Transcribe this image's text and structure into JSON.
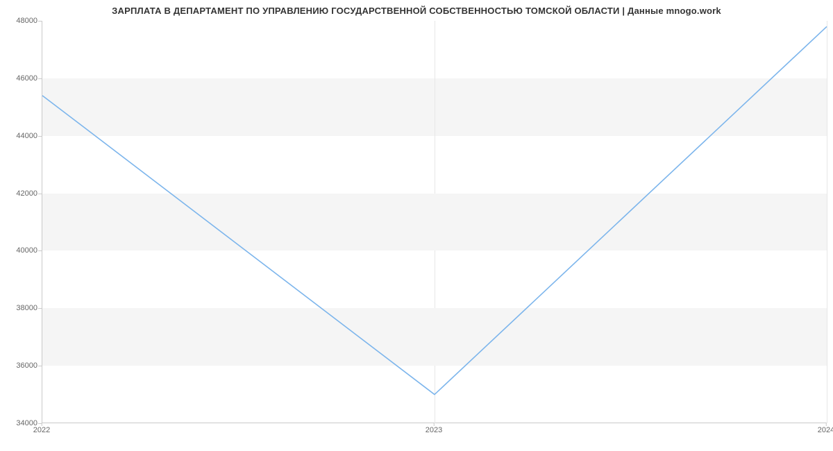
{
  "chart_data": {
    "type": "line",
    "title": "ЗАРПЛАТА В ДЕПАРТАМЕНТ ПО УПРАВЛЕНИЮ ГОСУДАРСТВЕННОЙ СОБСТВЕННОСТЬЮ ТОМСКОЙ ОБЛАСТИ | Данные mnogo.work",
    "x": [
      2022,
      2023,
      2024
    ],
    "values": [
      45400,
      35000,
      47800
    ],
    "xlabel": "",
    "ylabel": "",
    "xticks": [
      2022,
      2023,
      2024
    ],
    "yticks": [
      34000,
      36000,
      38000,
      40000,
      42000,
      44000,
      46000,
      48000
    ],
    "ylim": [
      34000,
      48000
    ],
    "xlim": [
      2022,
      2024
    ],
    "line_color": "#7cb5ec",
    "band_color": "#f5f5f5"
  }
}
